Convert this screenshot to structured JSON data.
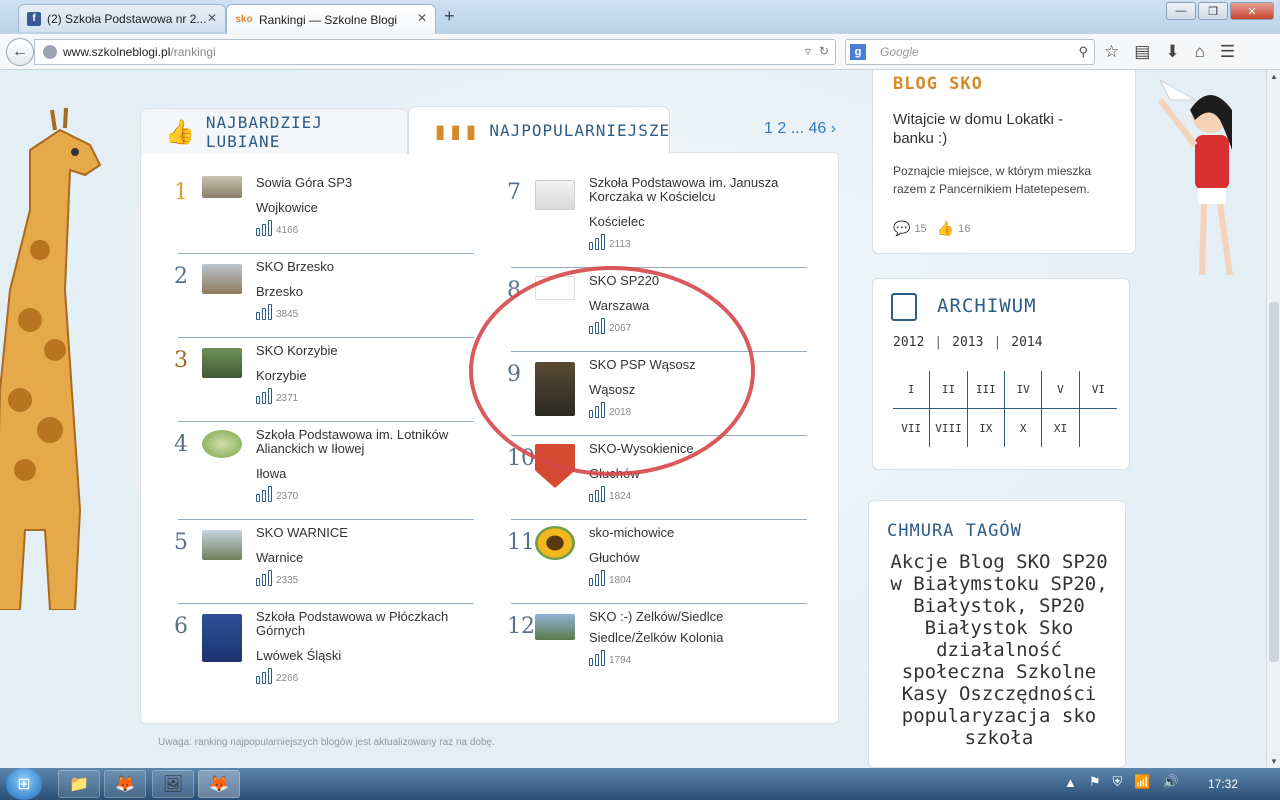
{
  "browser": {
    "tabs": [
      {
        "label": "(2) Szkoła Podstawowa nr 2...",
        "favicon": "facebook-icon"
      },
      {
        "label": "Rankingi — Szkolne Blogi",
        "favicon": "sko-icon",
        "active": true
      }
    ],
    "url": {
      "host": "www.szkolneblogi.pl",
      "path": "/rankingi"
    },
    "search_placeholder": "Google"
  },
  "ranking": {
    "tab_liked": "NAJBARDZIEJ LUBIANE",
    "tab_popular": "NAJPOPULARNIEJSZE",
    "pager": {
      "p1": "1",
      "p2": "2",
      "ellipsis": "...",
      "last": "46",
      "next": "›"
    },
    "left": [
      {
        "rank": "1",
        "name": "Sowia Góra SP3",
        "city": "Wojkowice",
        "count": "4166"
      },
      {
        "rank": "2",
        "name": "SKO Brzesko",
        "city": "Brzesko",
        "count": "3845"
      },
      {
        "rank": "3",
        "name": "SKO Korzybie",
        "city": "Korzybie",
        "count": "2371"
      },
      {
        "rank": "4",
        "name": "Szkoła Podstawowa im. Lotników Alianckich w Iłowej",
        "city": "Iłowa",
        "count": "2370"
      },
      {
        "rank": "5",
        "name": "SKO WARNICE",
        "city": "Warnice",
        "count": "2335"
      },
      {
        "rank": "6",
        "name": "Szkoła Podstawowa w Płóczkach Górnych",
        "city": "Lwówek Śląski",
        "count": "2266"
      }
    ],
    "right": [
      {
        "rank": "7",
        "name": "Szkoła Podstawowa im. Janusza Korczaka w Kościelcu",
        "city": "Kościelec",
        "count": "2113"
      },
      {
        "rank": "8",
        "name": "SKO SP220",
        "city": "Warszawa",
        "count": "2067"
      },
      {
        "rank": "9",
        "name": "SKO PSP Wąsosz",
        "city": "Wąsosz",
        "count": "2018"
      },
      {
        "rank": "10",
        "name": "SKO-Wysokienice",
        "city": "Głuchów",
        "count": "1824"
      },
      {
        "rank": "11",
        "name": "sko-michowice",
        "city": "Głuchów",
        "count": "1804"
      },
      {
        "rank": "12",
        "name": "SKO :-) Zelków/Siedlce",
        "city": "Siedlce/Żelków Kolonia",
        "count": "1794"
      }
    ],
    "note": "Uwaga: ranking najpopularniejszych blogów jest aktualizowany raz na dobę."
  },
  "sidebar": {
    "blog": {
      "title": "BLOG SKO",
      "post_title": "Witajcie w domu Lokatki - banku :)",
      "desc": "Poznajcie miejsce, w którym mieszka razem z Pancernikiem Hatetepesem.",
      "comments": "15",
      "likes": "16"
    },
    "archive": {
      "title": "ARCHIWUM",
      "years": [
        "2012",
        "2013",
        "2014"
      ],
      "months": [
        "I",
        "II",
        "III",
        "IV",
        "V",
        "VI",
        "VII",
        "VIII",
        "IX",
        "X",
        "XI",
        ""
      ]
    },
    "tags": {
      "title": "CHMURA TAGÓW",
      "cloud": "Akcje Blog SKO SP20 w Białymstoku SP20, Białystok, SP20 Białystok Sko działalność społeczna Szkolne Kasy Oszczędności popularyzacja sko szkoła"
    }
  },
  "taskbar": {
    "time": "17:32"
  },
  "colors": {
    "accent": "#2d5c86",
    "highlight": "#d6474a",
    "gold": "#d6a12a"
  }
}
